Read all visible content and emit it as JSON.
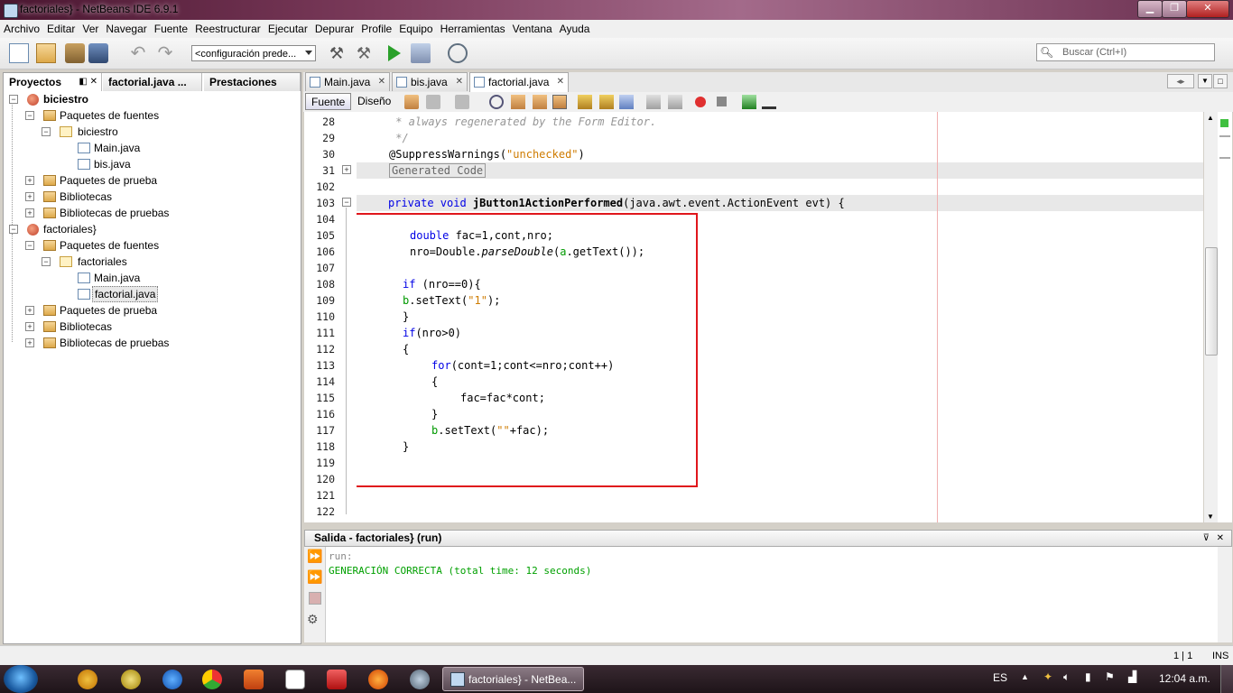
{
  "window": {
    "title": "factoriales} - NetBeans IDE 6.9.1",
    "minimize_label": "▁",
    "maximize_label": "❐",
    "close_label": "✕"
  },
  "menu": [
    "Archivo",
    "Editar",
    "Ver",
    "Navegar",
    "Fuente",
    "Reestructurar",
    "Ejecutar",
    "Depurar",
    "Profile",
    "Equipo",
    "Herramientas",
    "Ventana",
    "Ayuda"
  ],
  "toolbar": {
    "config_value": "<configuración prede...",
    "search_placeholder": "Buscar (Ctrl+I)"
  },
  "left_tabs": [
    "Proyectos",
    "factorial.java ...",
    "Prestaciones"
  ],
  "tree": [
    {
      "label": "biciestro",
      "bold": true
    },
    {
      "label": "Paquetes de fuentes"
    },
    {
      "label": "biciestro"
    },
    {
      "label": "Main.java"
    },
    {
      "label": "bis.java"
    },
    {
      "label": "Paquetes de prueba"
    },
    {
      "label": "Bibliotecas"
    },
    {
      "label": "Bibliotecas de pruebas"
    },
    {
      "label": "factoriales}"
    },
    {
      "label": "Paquetes de fuentes"
    },
    {
      "label": "factoriales"
    },
    {
      "label": "Main.java"
    },
    {
      "label": "factorial.java"
    },
    {
      "label": "Paquetes de prueba"
    },
    {
      "label": "Bibliotecas"
    },
    {
      "label": "Bibliotecas de pruebas"
    }
  ],
  "editor_tabs": [
    "Main.java",
    "bis.java",
    "factorial.java"
  ],
  "editor_modes": {
    "source": "Fuente",
    "design": "Diseño"
  },
  "code": {
    "line_numbers": [
      "28",
      "29",
      "30",
      "31",
      "102",
      "103",
      "104",
      "105",
      "106",
      "107",
      "108",
      "109",
      "110",
      "111",
      "112",
      "113",
      "114",
      "115",
      "116",
      "117",
      "118",
      "119",
      "120",
      "121",
      "122"
    ],
    "l28": " * always regenerated by the Form Editor.",
    "l29": " */",
    "l30_a": "@SuppressWarnings(",
    "l30_b": "\"unchecked\"",
    "l30_c": ")",
    "l31": "Generated Code",
    "l103_kw": "private void ",
    "l103_name": "jButton1ActionPerformed",
    "l103_rest": "(java.awt.event.ActionEvent evt) {",
    "l105_kw": "double",
    "l105_rest": " fac=1,cont,nro;",
    "l106_a": "nro=Double.",
    "l106_b": "parseDouble",
    "l106_c": "(",
    "l106_d": "a",
    "l106_e": ".getText());",
    "l108_kw": "if",
    "l108_rest": " (nro==0){",
    "l109_a": "b",
    "l109_b": ".setText(",
    "l109_c": "\"1\"",
    "l109_d": ");",
    "l110": "}",
    "l111_kw": "if",
    "l111_rest": "(nro>0)",
    "l112": "{",
    "l113_kw": "for",
    "l113_rest": "(cont=1;cont<=nro;cont++)",
    "l114": "{",
    "l115": "fac=fac*cont;",
    "l116": "}",
    "l117_a": "b",
    "l117_b": ".setText(",
    "l117_c": "\"\"",
    "l117_d": "+fac);",
    "l118": "}"
  },
  "output": {
    "title": "Salida - factoriales} (run)",
    "line1": "run:",
    "line2": "GENERACIÓN CORRECTA (total time: 12 seconds)"
  },
  "status": {
    "position": "1 | 1",
    "mode": "INS"
  },
  "taskbar": {
    "active_app": "factoriales} - NetBea...",
    "lang": "ES",
    "clock": "12:04 a.m."
  },
  "colors": {
    "highlight_box": "#e0161c",
    "keyword": "#0000e6",
    "string": "#ce7b00",
    "comment": "#969696",
    "output_green": "#00a000"
  }
}
